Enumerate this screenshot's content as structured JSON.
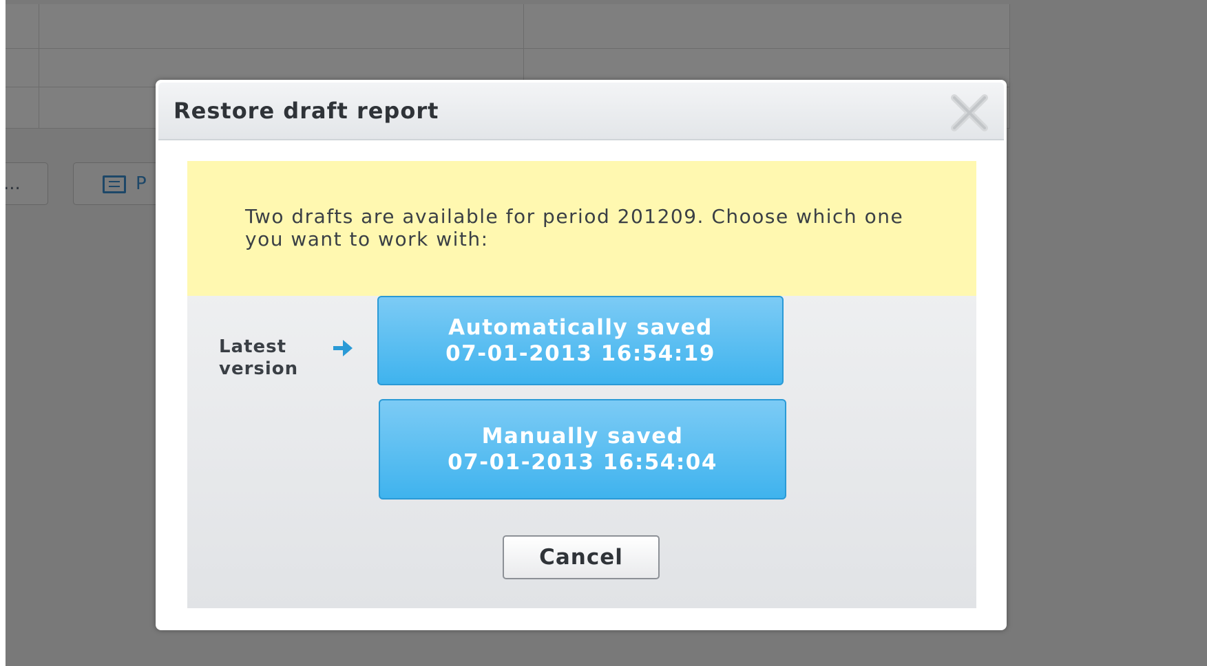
{
  "background": {
    "button_1_label": "...",
    "button_2_label": "P"
  },
  "dialog": {
    "title": "Restore draft report",
    "close_icon": "close-icon",
    "notice": "Two drafts are available for period 201209. Choose which one you want to work with:",
    "latest_label": "Latest version",
    "arrow_icon": "arrow-right-icon",
    "drafts": [
      {
        "type": "Automatically saved",
        "timestamp": "07-01-2013 16:54:19"
      },
      {
        "type": "Manually saved",
        "timestamp": "07-01-2013 16:54:04"
      }
    ],
    "cancel_label": "Cancel"
  },
  "colors": {
    "accent": "#4ab8f0",
    "notice_bg": "#fff8b0",
    "overlay": "rgba(0,0,0,0.5)"
  }
}
